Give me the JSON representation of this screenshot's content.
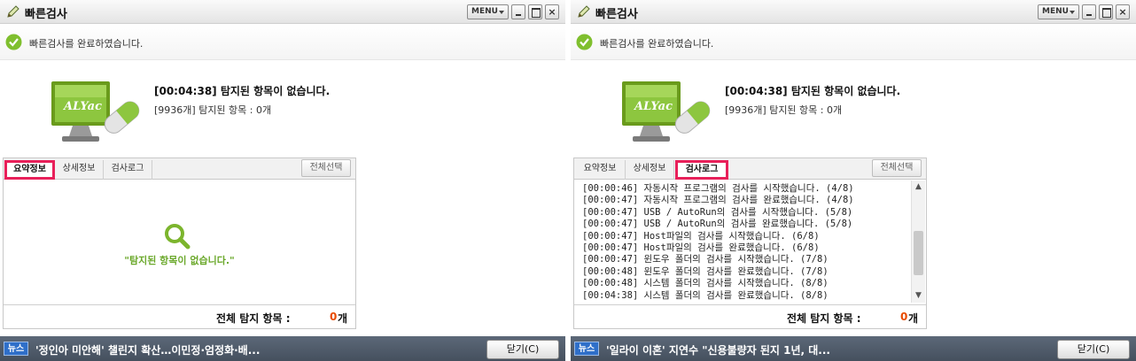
{
  "windows": [
    {
      "title": "빠른검사",
      "menu_label": "MENU",
      "close_glyph": "×",
      "status_text": "빠른검사를 완료하였습니다.",
      "logo_text": "ALYac",
      "result_line": "[00:04:38]  탐지된 항목이 없습니다.",
      "result_sub": "[9936개] 탐지된 항목 : 0개",
      "tabs": [
        "요약정보",
        "상세정보",
        "검사로그"
      ],
      "active_tab": "요약정보",
      "select_all": "전체선택",
      "empty_message": "\"탐지된 항목이 없습니다.\"",
      "total_label": "전체 탐지 항목 :",
      "total_count": "0",
      "total_unit": "개",
      "news_badge": "뉴스",
      "news_text": "'정인아 미안해' 챌린지 확산…이민정·엄정화·배...",
      "close_button": "닫기(C)"
    },
    {
      "title": "빠른검사",
      "menu_label": "MENU",
      "close_glyph": "×",
      "status_text": "빠른검사를 완료하였습니다.",
      "logo_text": "ALYac",
      "result_line": "[00:04:38]  탐지된 항목이 없습니다.",
      "result_sub": "[9936개] 탐지된 항목 : 0개",
      "tabs": [
        "요약정보",
        "상세정보",
        "검사로그"
      ],
      "active_tab": "검사로그",
      "select_all": "전체선택",
      "log_lines": [
        "[00:00:46] 자동시작 프로그램의 검사를 시작했습니다. (4/8)",
        "[00:00:47] 자동시작 프로그램의 검사를 완료했습니다. (4/8)",
        "[00:00:47] USB / AutoRun의 검사를 시작했습니다. (5/8)",
        "[00:00:47] USB / AutoRun의 검사를 완료했습니다. (5/8)",
        "[00:00:47] Host파일의 검사를 시작했습니다. (6/8)",
        "[00:00:47] Host파일의 검사를 완료했습니다. (6/8)",
        "[00:00:47] 윈도우 폴더의 검사를 시작했습니다. (7/8)",
        "[00:00:48] 윈도우 폴더의 검사를 완료했습니다. (7/8)",
        "[00:00:48] 시스템 폴더의 검사를 시작했습니다. (8/8)",
        "[00:04:38] 시스템 폴더의 검사를 완료했습니다. (8/8)"
      ],
      "total_label": "전체 탐지 항목 :",
      "total_count": "0",
      "total_unit": "개",
      "news_badge": "뉴스",
      "news_text": "'일라이 이혼' 지연수 \"신용불량자 된지 1년, 대...",
      "close_button": "닫기(C)"
    }
  ],
  "colors": {
    "highlight": "#e8205a",
    "accent_green": "#8cc63f",
    "count_orange": "#e84a00",
    "news_bar": "#4f5a69"
  },
  "icons": [
    "pencil-icon",
    "check-circle-icon",
    "alyac-monitor-logo",
    "magnifier-icon",
    "scroll-up-arrow-icon",
    "scroll-down-arrow-icon"
  ]
}
